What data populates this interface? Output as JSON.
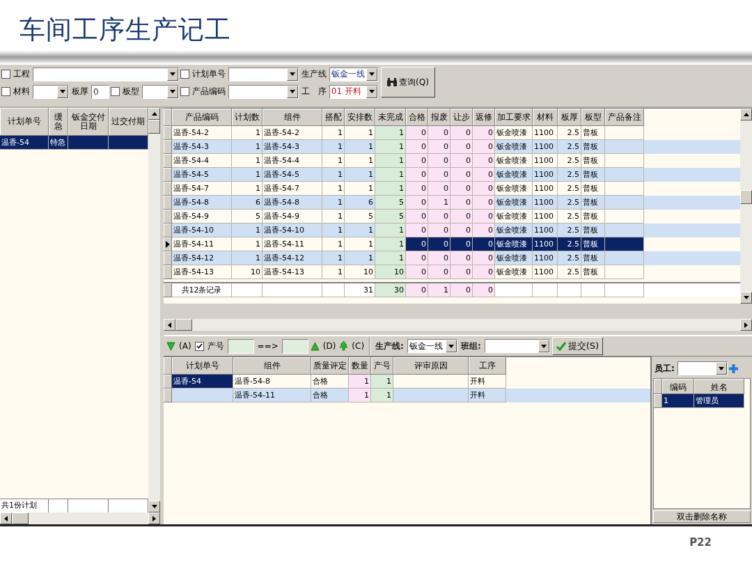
{
  "slide": {
    "title": "车间工序生产记工",
    "page": "P22"
  },
  "filters": {
    "project": {
      "label": "工程",
      "checked": false
    },
    "plan_no": {
      "label": "计划单号",
      "checked": false
    },
    "production_line": {
      "label": "生产线",
      "value": "钣金一线"
    },
    "material": {
      "label": "材料",
      "checked": false
    },
    "thickness": {
      "label": "板厚",
      "value": "0"
    },
    "board_type": {
      "label": "板型",
      "checked": false
    },
    "product_code": {
      "label": "产品编码",
      "checked": false
    },
    "process": {
      "label": "工 序",
      "value": "01 开料"
    },
    "query_button": "查询(Q)"
  },
  "plan_panel": {
    "columns": [
      {
        "label": "计划单号",
        "kind": "text"
      },
      {
        "label": "缓急",
        "kind": "text"
      },
      {
        "label": "钣金交付日期",
        "kind": "text"
      },
      {
        "label": "过交付期",
        "kind": "text"
      }
    ],
    "rows": [
      {
        "cells": [
          "温香-54",
          "特急"
        ],
        "selected": true
      }
    ],
    "footer": "共1份计划"
  },
  "product_grid": {
    "columns": [
      {
        "label": "产品编码",
        "kind": "text"
      },
      {
        "label": "计划数",
        "kind": "number"
      },
      {
        "label": "组件",
        "kind": "text"
      },
      {
        "label": "搭配",
        "kind": "number"
      },
      {
        "label": "安排数",
        "kind": "number"
      },
      {
        "label": "未完成",
        "kind": "pending"
      },
      {
        "label": "合格",
        "kind": "quality"
      },
      {
        "label": "报废",
        "kind": "quality"
      },
      {
        "label": "让步",
        "kind": "quality"
      },
      {
        "label": "返修",
        "kind": "quality"
      },
      {
        "label": "加工要求",
        "kind": "text"
      },
      {
        "label": "材料",
        "kind": "text"
      },
      {
        "label": "板厚",
        "kind": "number"
      },
      {
        "label": "板型",
        "kind": "text"
      },
      {
        "label": "产品备注",
        "kind": "text"
      }
    ],
    "rows": [
      {
        "cells": [
          "温香-54-2",
          "1",
          "温香-54-2",
          "1",
          "1",
          "1",
          "0",
          "0",
          "0",
          "0",
          "钣金喷漆",
          "1100",
          "2.5",
          "普板"
        ],
        "selected": false
      },
      {
        "cells": [
          "温香-54-3",
          "1",
          "温香-54-3",
          "1",
          "1",
          "1",
          "0",
          "0",
          "0",
          "0",
          "钣金喷漆",
          "1100",
          "2.5",
          "普板"
        ],
        "selected": false
      },
      {
        "cells": [
          "温香-54-4",
          "1",
          "温香-54-4",
          "1",
          "1",
          "1",
          "0",
          "0",
          "0",
          "0",
          "钣金喷漆",
          "1100",
          "2.5",
          "普板"
        ],
        "selected": false
      },
      {
        "cells": [
          "温香-54-5",
          "1",
          "温香-54-5",
          "1",
          "1",
          "1",
          "0",
          "0",
          "0",
          "0",
          "钣金喷漆",
          "1100",
          "2.5",
          "普板"
        ],
        "selected": false
      },
      {
        "cells": [
          "温香-54-7",
          "1",
          "温香-54-7",
          "1",
          "1",
          "1",
          "0",
          "0",
          "0",
          "0",
          "钣金喷漆",
          "1100",
          "2.5",
          "普板"
        ],
        "selected": false
      },
      {
        "cells": [
          "温香-54-8",
          "6",
          "温香-54-8",
          "1",
          "6",
          "5",
          "0",
          "1",
          "0",
          "0",
          "钣金喷漆",
          "1100",
          "2.5",
          "普板"
        ],
        "selected": false
      },
      {
        "cells": [
          "温香-54-9",
          "5",
          "温香-54-9",
          "1",
          "5",
          "5",
          "0",
          "0",
          "0",
          "0",
          "钣金喷漆",
          "1100",
          "2.5",
          "普板"
        ],
        "selected": false
      },
      {
        "cells": [
          "温香-54-10",
          "1",
          "温香-54-10",
          "1",
          "1",
          "1",
          "0",
          "0",
          "0",
          "0",
          "钣金喷漆",
          "1100",
          "2.5",
          "普板"
        ],
        "selected": false
      },
      {
        "cells": [
          "温香-54-11",
          "1",
          "温香-54-11",
          "1",
          "1",
          "1",
          "0",
          "0",
          "0",
          "0",
          "钣金喷漆",
          "1100",
          "2.5",
          "普板"
        ],
        "selected": true
      },
      {
        "cells": [
          "温香-54-12",
          "1",
          "温香-54-12",
          "1",
          "1",
          "1",
          "0",
          "0",
          "0",
          "0",
          "钣金喷漆",
          "1100",
          "2.5",
          "普板"
        ],
        "selected": false
      },
      {
        "cells": [
          "温香-54-13",
          "10",
          "温香-54-13",
          "1",
          "10",
          "10",
          "0",
          "0",
          "0",
          "0",
          "钣金喷漆",
          "1100",
          "2.5",
          "普板"
        ],
        "selected": false
      }
    ],
    "footer": {
      "label": "共12条记录",
      "totals": [
        "31",
        "30",
        "0",
        "1",
        "0",
        "0"
      ]
    }
  },
  "entry_toolbar": {
    "down_hint": "(A)",
    "serial_check": {
      "label": "产号",
      "checked": true
    },
    "arrow": "==>",
    "up_hint": "(D)",
    "tree_hint": "(C)",
    "line_label": "生产线:",
    "line_value": "钣金一线",
    "team_label": "班组:",
    "submit": "提交(S)"
  },
  "entry_grid": {
    "columns": [
      {
        "label": "计划单号",
        "kind": "text"
      },
      {
        "label": "组件",
        "kind": "text"
      },
      {
        "label": "质量评定",
        "kind": "text"
      },
      {
        "label": "数量",
        "kind": "quality"
      },
      {
        "label": "产号",
        "kind": "pending"
      },
      {
        "label": "评审原因",
        "kind": "text"
      },
      {
        "label": "工序",
        "kind": "text"
      }
    ],
    "rows": [
      {
        "cells": [
          "温香-54",
          "温香-54-8",
          "合格",
          "1",
          "1",
          null,
          "开料"
        ],
        "selected": true
      },
      {
        "cells": [
          null,
          "温香-54-11",
          "合格",
          "1",
          "1",
          null,
          "开料"
        ],
        "selected": false
      }
    ]
  },
  "staff_panel": {
    "label": "员工:",
    "columns": [
      {
        "label": "编码",
        "kind": "text"
      },
      {
        "label": "姓名",
        "kind": "text"
      }
    ],
    "rows": [
      {
        "cells": [
          "1",
          "管理员"
        ],
        "selected": true
      }
    ],
    "footer": "双击删除名称"
  }
}
